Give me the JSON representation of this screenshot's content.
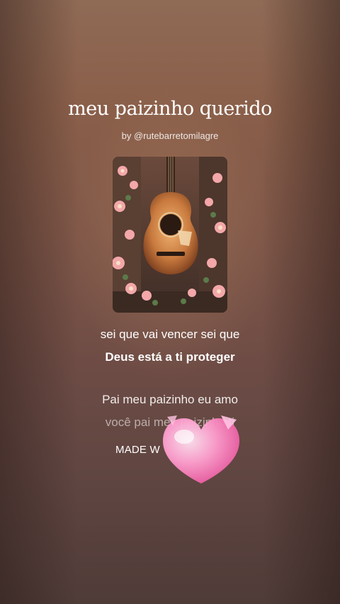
{
  "song": {
    "title": "meu paizinho querido",
    "byline": "by @rutebarretomilagre"
  },
  "lyrics": {
    "line1": "sei que vai vencer sei que",
    "line2": "Deus está a ti proteger",
    "line3": "Pai meu paizinho eu amo",
    "line4": "você pai meu paizinho ti"
  },
  "watermark": {
    "text": "MADE W"
  },
  "icons": {
    "cover": "guitar-with-flowers-artwork",
    "sticker": "pink-heart-sticker-icon"
  },
  "colors": {
    "background_top": "#8f6a55",
    "background_bottom": "#4f3b38",
    "heart": "#ff8fc6"
  }
}
